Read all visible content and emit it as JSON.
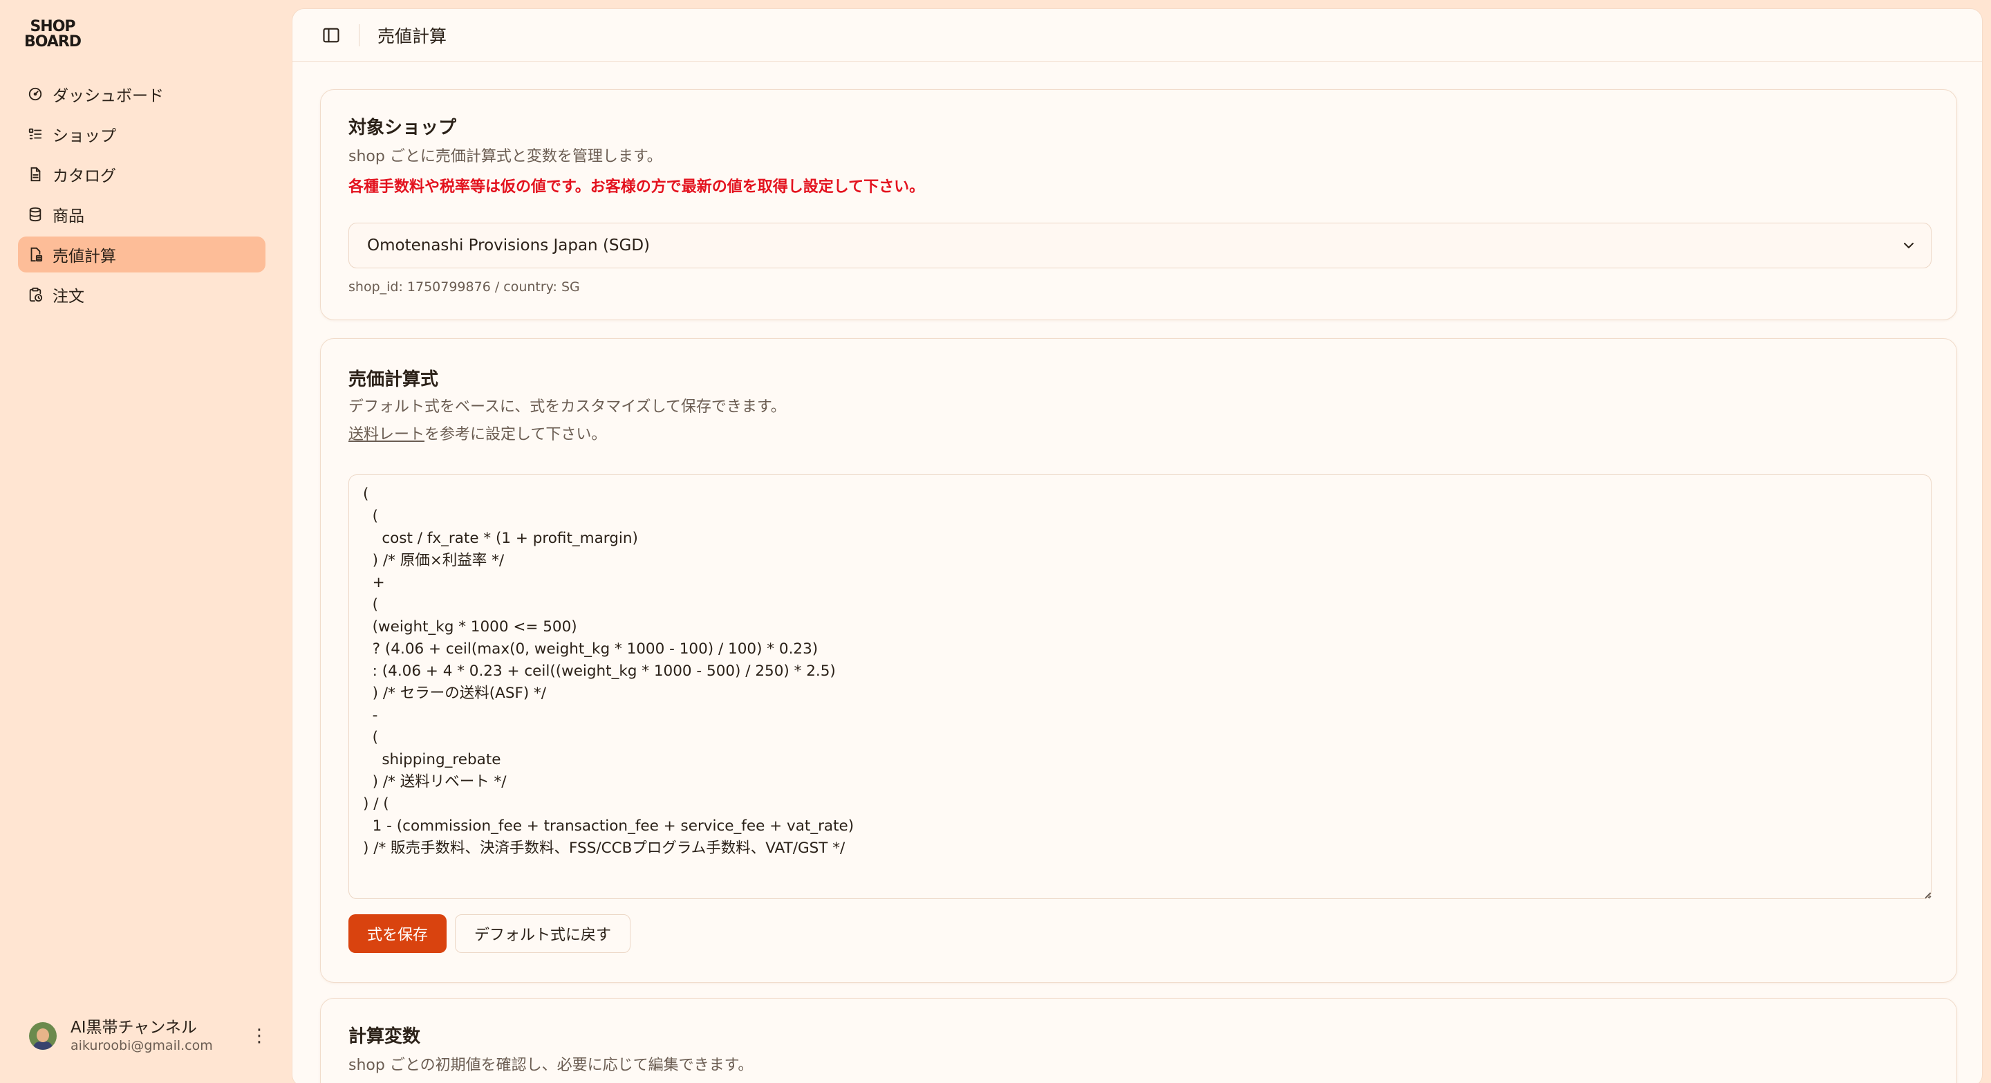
{
  "brand": {
    "line1": "SHOP",
    "line2": "BOARD"
  },
  "sidebar": {
    "items": [
      {
        "label": "ダッシュボード",
        "icon": "gauge-icon"
      },
      {
        "label": "ショップ",
        "icon": "list-icon"
      },
      {
        "label": "カタログ",
        "icon": "document-icon"
      },
      {
        "label": "商品",
        "icon": "database-icon"
      },
      {
        "label": "売値計算",
        "icon": "calculator-file-icon",
        "active": true
      },
      {
        "label": "注文",
        "icon": "clipboard-clock-icon"
      }
    ]
  },
  "user": {
    "name": "AI黒帯チャンネル",
    "email": "aikuroobi@gmail.com"
  },
  "header": {
    "title": "売値計算"
  },
  "shop_card": {
    "title": "対象ショップ",
    "description": "shop ごとに売価計算式と変数を管理します。",
    "warning": "各種手数料や税率等は仮の値です。お客様の方で最新の値を取得し設定して下さい。",
    "selected_shop": "Omotenashi Provisions Japan (SGD)",
    "meta": "shop_id: 1750799876 / country: SG"
  },
  "formula_card": {
    "title": "売価計算式",
    "description": "デフォルト式をベースに、式をカスタマイズして保存できます。",
    "link_text": "送料レート",
    "link_suffix": "を参考に設定して下さい。",
    "formula": "(\n  (\n    cost / fx_rate * (1 + profit_margin)\n  ) /* 原価×利益率 */\n  +\n  (\n  (weight_kg * 1000 <= 500)\n  ? (4.06 + ceil(max(0, weight_kg * 1000 - 100) / 100) * 0.23)\n  : (4.06 + 4 * 0.23 + ceil((weight_kg * 1000 - 500) / 250) * 2.5)\n  ) /* セラーの送料(ASF) */\n  -\n  (\n    shipping_rebate\n  ) /* 送料リベート */\n) / (\n  1 - (commission_fee + transaction_fee + service_fee + vat_rate)\n) /* 販売手数料、決済手数料、FSS/CCBプログラム手数料、VAT/GST */",
    "save_label": "式を保存",
    "reset_label": "デフォルト式に戻す"
  },
  "vars_card": {
    "title": "計算変数",
    "description": "shop ごとの初期値を確認し、必要に応じて編集できます。"
  },
  "colors": {
    "accent": "#d9430f",
    "sidebar_bg": "#ffe5d2",
    "active_bg": "#fdbd98",
    "warning": "#e3121e"
  }
}
